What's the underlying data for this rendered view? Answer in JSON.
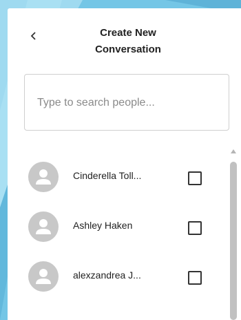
{
  "header": {
    "back_icon": "chevron-left-icon",
    "title_line1": "Create New",
    "title_line2": "Conversation"
  },
  "search": {
    "value": "",
    "placeholder": "Type to search people..."
  },
  "people": [
    {
      "name": "Cinderella Toll...",
      "checked": false
    },
    {
      "name": "Ashley Haken",
      "checked": false
    },
    {
      "name": "alexzandrea J...",
      "checked": false
    }
  ],
  "colors": {
    "background": "#7ccbe8",
    "panel": "#ffffff",
    "avatar": "#c8c8c8"
  }
}
